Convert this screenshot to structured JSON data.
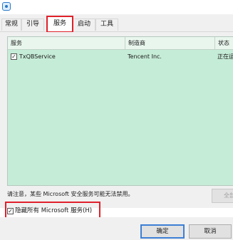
{
  "tabs": [
    {
      "label": "常规"
    },
    {
      "label": "引导"
    },
    {
      "label": "服务"
    },
    {
      "label": "启动"
    },
    {
      "label": "工具"
    }
  ],
  "services_table": {
    "columns": [
      "服务",
      "制造商",
      "状态"
    ],
    "rows": [
      {
        "service": "TxQBService",
        "manufacturer": "Tencent Inc.",
        "status": "正在运",
        "checked": true
      }
    ]
  },
  "note": "请注意，某些 Microsoft 安全服务可能无法禁用。",
  "disable_all_button": "全部",
  "hide_ms_checkbox": {
    "label": "隐藏所有 Microsoft 服务(H)",
    "checked": true
  },
  "footer": {
    "ok_label": "确定",
    "cancel_label": "取消"
  },
  "icons": {
    "app": "system-config-icon",
    "check": "checkmark-icon"
  },
  "colors": {
    "table_bg": "#c5ecd6",
    "highlight_border": "#e0202a",
    "default_button_border": "#3c7fd6"
  }
}
